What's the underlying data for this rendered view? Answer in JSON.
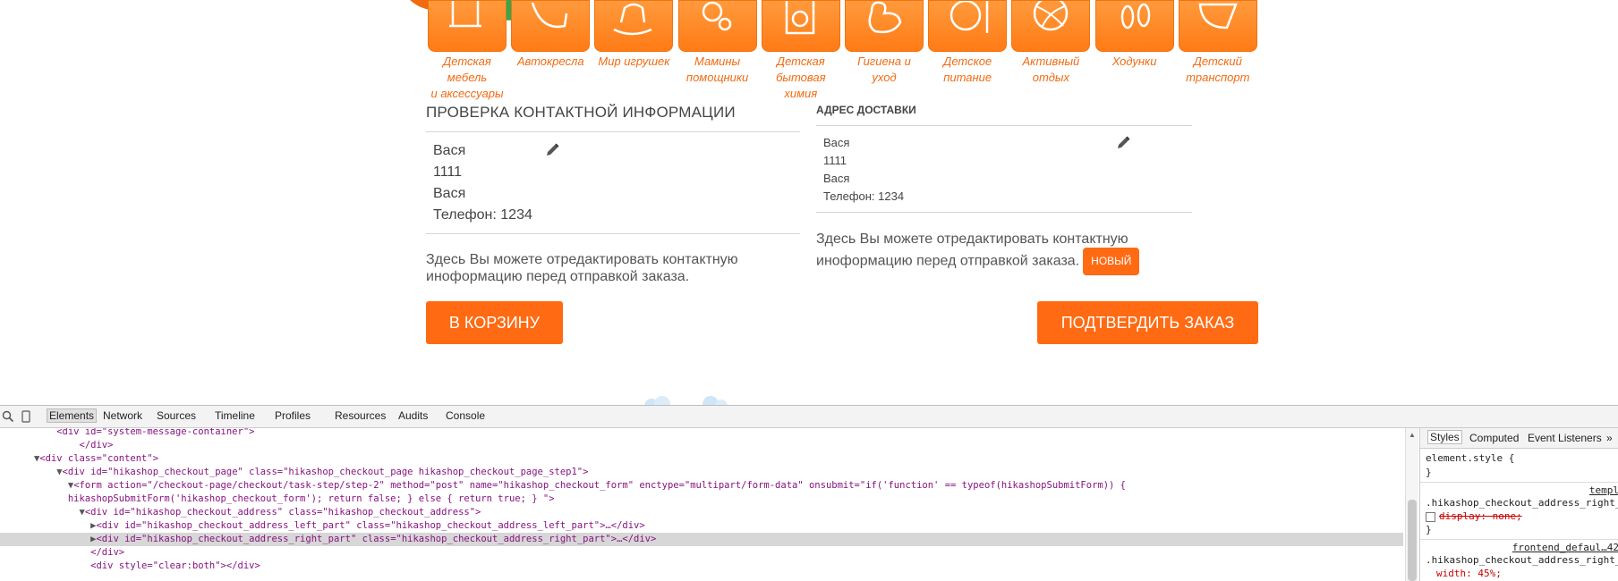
{
  "categories": [
    {
      "label": "Детская мебель\nи аксессуары",
      "icon": "chair-icon"
    },
    {
      "label": "Автокресла",
      "icon": "car-seat-icon"
    },
    {
      "label": "Мир игрушек",
      "icon": "rocking-horse-icon"
    },
    {
      "label": "Мамины\nпомощники",
      "icon": "pacifier-icon"
    },
    {
      "label": "Детская\nбытовая химия",
      "icon": "washing-machine-icon"
    },
    {
      "label": "Гигиена и уход",
      "icon": "duck-icon"
    },
    {
      "label": "Детское\nпитание",
      "icon": "plate-icon"
    },
    {
      "label": "Активный\nотдых",
      "icon": "ball-icon"
    },
    {
      "label": "Ходунки",
      "icon": "footprints-icon"
    },
    {
      "label": "Детский\nтранспорт",
      "icon": "stroller-icon"
    }
  ],
  "checkout": {
    "left_heading": "ПРОВЕРКА КОНТАКТНОЙ ИНФОРМАЦИИ",
    "right_heading": "АДРЕС ДОСТАВКИ",
    "left_address": [
      "Вася",
      "1111",
      "Вася",
      "Телефон: 1234"
    ],
    "right_address": [
      "Вася",
      "1111",
      "Вася",
      "Телефон: 1234"
    ],
    "left_note": "Здесь Вы можете отредактировать контактную иноформацию перед отправкой заказа.",
    "right_note": "Здесь Вы можете отредактировать контактную иноформацию перед отправкой заказа.",
    "new_label": "НОВЫЙ",
    "cart_button": "В КОРЗИНУ",
    "confirm_button": "ПОДТВЕРДИТЬ ЗАКАЗ",
    "accent_color": "#ff6a13"
  },
  "devtools": {
    "tabs": [
      "Elements",
      "Network",
      "Sources",
      "Timeline",
      "Profiles",
      "Resources",
      "Audits",
      "Console"
    ],
    "active_tab": "Elements",
    "dom_lines": [
      {
        "indent": 4,
        "arrow": "",
        "html": "<div id=\"system-message-container\">",
        "selected": false
      },
      {
        "indent": 6,
        "arrow": "",
        "html": "</div>",
        "selected": false
      },
      {
        "indent": 2,
        "arrow": "▼",
        "html": "<div class=\"content\">",
        "selected": false
      },
      {
        "indent": 4,
        "arrow": "▼",
        "html": "<div id=\"hikashop_checkout_page\" class=\"hikashop_checkout_page hikashop_checkout_page_step1\">",
        "selected": false
      },
      {
        "indent": 5,
        "arrow": "▼",
        "html": "<form action=\"/checkout-page/checkout/task-step/step-2\" method=\"post\" name=\"hikashop_checkout_form\" enctype=\"multipart/form-data\" onsubmit=\"if('function' == typeof(hikashopSubmitForm)) {",
        "selected": false
      },
      {
        "indent": 5,
        "arrow": "",
        "html": "hikashopSubmitForm('hikashop_checkout_form'); return false; } else { return true; } \">",
        "selected": false
      },
      {
        "indent": 6,
        "arrow": "▼",
        "html": "<div id=\"hikashop_checkout_address\" class=\"hikashop_checkout_address\">",
        "selected": false
      },
      {
        "indent": 7,
        "arrow": "▶",
        "html": "<div id=\"hikashop_checkout_address_left_part\" class=\"hikashop_checkout_address_left_part\">…</div>",
        "selected": false
      },
      {
        "indent": 7,
        "arrow": "▶",
        "html": "<div id=\"hikashop_checkout_address_right_part\" class=\"hikashop_checkout_address_right_part\">…</div>",
        "selected": true
      },
      {
        "indent": 7,
        "arrow": "",
        "html": "</div>",
        "selected": false
      },
      {
        "indent": 7,
        "arrow": "",
        "html": "<div style=\"clear:both\"></div>",
        "selected": false
      }
    ],
    "styles_tabs": [
      "Styles",
      "Computed",
      "Event Listeners"
    ],
    "styles_more": "»",
    "element_style": "element.style {",
    "close_brace": "}",
    "rule1_source": "templ",
    "rule1_selector": ".hikashop_checkout_address_right_",
    "rule1_prop": "display: none;",
    "rule2_source": "frontend_defaul…42",
    "rule2_selector": ".hikashop_checkout_address_right_",
    "rule2_prop": "width: 45%;"
  }
}
